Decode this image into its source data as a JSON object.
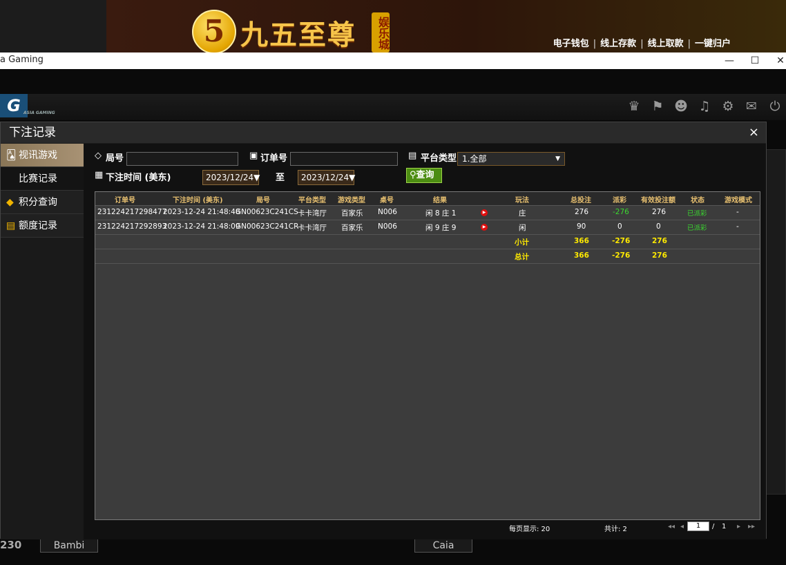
{
  "banner": {
    "logo_char": "5",
    "brand": "九五至尊",
    "tag": "娱乐城",
    "links": [
      "电子钱包",
      "线上存款",
      "线上取款",
      "一键归户"
    ]
  },
  "window": {
    "title": "a Gaming",
    "min": "—",
    "max": "☐",
    "close": "✕"
  },
  "game": {
    "logo": "G",
    "logo_sub": "ASIA GAMING",
    "bottom_num": "230",
    "bottom_names": [
      "Bambi",
      "Caia"
    ]
  },
  "modal": {
    "title": "下注记录",
    "close": "×",
    "sidebar": [
      {
        "label": "视讯游戏",
        "icon": "cards-icon",
        "active": true
      },
      {
        "label": "比赛记录",
        "sub": true
      },
      {
        "label": "积分查询",
        "icon": "diamond-icon"
      },
      {
        "label": "额度记录",
        "icon": "document-icon"
      }
    ],
    "filters": {
      "round_label": "局号",
      "order_label": "订单号",
      "platform_label": "平台类型",
      "platform_value": "1.全部",
      "time_label": "下注时间 (美东)",
      "date_from": "2023/12/24▼",
      "to_label": "至",
      "date_to": "2023/12/24▼",
      "query_label": "查询"
    },
    "table": {
      "headers": [
        "订单号",
        "下注时间 (美东)",
        "局号",
        "平台类型",
        "游戏类型",
        "桌号",
        "结果",
        "玩法",
        "总投注",
        "派彩",
        "有效投注额",
        "状态",
        "游戏模式"
      ],
      "rows": [
        {
          "order": "231224217298477",
          "time": "2023-12-24 21:48:48",
          "round": "GN00623C241CS",
          "platform": "卡卡湾厅",
          "game": "百家乐",
          "table": "N006",
          "result": "闲 8 庄 1",
          "play": "庄",
          "total": "276",
          "payout": "-276",
          "valid": "276",
          "status": "已派彩",
          "mode": "-"
        },
        {
          "order": "231224217292893",
          "time": "2023-12-24 21:48:09",
          "round": "GN00623C241CR",
          "platform": "卡卡湾厅",
          "game": "百家乐",
          "table": "N006",
          "result": "闲 9 庄 9",
          "play": "闲",
          "total": "90",
          "payout": "0",
          "valid": "0",
          "status": "已派彩",
          "mode": "-"
        }
      ],
      "subtotal": {
        "label": "小计",
        "total": "366",
        "payout": "-276",
        "valid": "276"
      },
      "grandtotal": {
        "label": "总计",
        "total": "366",
        "payout": "-276",
        "valid": "276"
      }
    },
    "footer": {
      "per_page": "每页显示: 20",
      "count": "共计: 2",
      "page": "1",
      "page_sep": "/",
      "page_total": "1"
    }
  }
}
